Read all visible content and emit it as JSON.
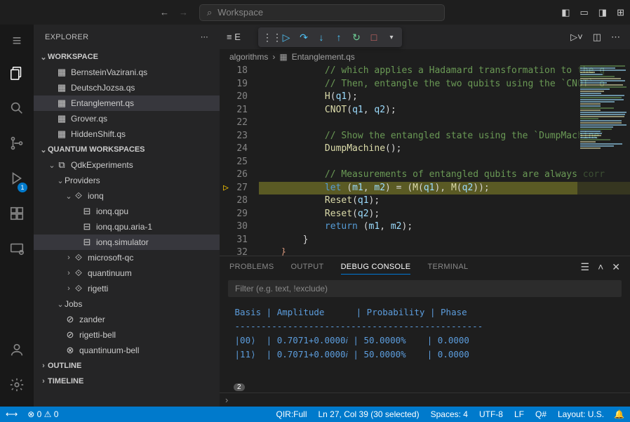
{
  "titlebar": {
    "search_placeholder": "Workspace"
  },
  "sidebar": {
    "title": "EXPLORER",
    "workspace_header": "WORKSPACE",
    "files": [
      "BernsteinVazirani.qs",
      "DeutschJozsa.qs",
      "Entanglement.qs",
      "Grover.qs",
      "HiddenShift.qs"
    ],
    "selected_file_index": 2,
    "quantum_header": "QUANTUM WORKSPACES",
    "quantum_root": "QdkExperiments",
    "providers_label": "Providers",
    "providers": [
      {
        "name": "ionq",
        "expanded": true,
        "targets": [
          "ionq.qpu",
          "ionq.qpu.aria-1",
          "ionq.simulator"
        ]
      },
      {
        "name": "microsoft-qc",
        "expanded": false
      },
      {
        "name": "quantinuum",
        "expanded": false
      },
      {
        "name": "rigetti",
        "expanded": false
      }
    ],
    "jobs_label": "Jobs",
    "jobs": [
      {
        "name": "zander",
        "status": "ok"
      },
      {
        "name": "rigetti-bell",
        "status": "ok"
      },
      {
        "name": "quantinuum-bell",
        "status": "fail"
      }
    ],
    "outline": "OUTLINE",
    "timeline": "TIMELINE"
  },
  "breadcrumbs": {
    "folder": "algorithms",
    "file": "Entanglement.qs"
  },
  "editor": {
    "first_line_no": 18,
    "highlight_index": 9,
    "lines": [
      {
        "indent": 2,
        "segs": [
          [
            "c",
            "// which applies a Hadamard transformation to the q"
          ]
        ]
      },
      {
        "indent": 2,
        "segs": [
          [
            "c",
            "// Then, entangle the two qubits using the `CNOT` o"
          ]
        ]
      },
      {
        "indent": 2,
        "segs": [
          [
            "fn",
            "H"
          ],
          [
            "p",
            "("
          ],
          [
            "v",
            "q1"
          ],
          [
            "p",
            ");"
          ]
        ]
      },
      {
        "indent": 2,
        "segs": [
          [
            "fn",
            "CNOT"
          ],
          [
            "p",
            "("
          ],
          [
            "v",
            "q1"
          ],
          [
            "p",
            ", "
          ],
          [
            "v",
            "q2"
          ],
          [
            "p",
            ");"
          ]
        ]
      },
      {
        "indent": 0,
        "segs": []
      },
      {
        "indent": 2,
        "segs": [
          [
            "c",
            "// Show the entangled state using the `DumpMachine`"
          ]
        ]
      },
      {
        "indent": 2,
        "segs": [
          [
            "fn",
            "DumpMachine"
          ],
          [
            "p",
            "();"
          ]
        ]
      },
      {
        "indent": 0,
        "segs": []
      },
      {
        "indent": 2,
        "segs": [
          [
            "c",
            "// Measurements of entangled qubits are always corr"
          ]
        ]
      },
      {
        "indent": 2,
        "segs": [
          [
            "kw",
            "let"
          ],
          [
            "p",
            " ("
          ],
          [
            "v",
            "m1"
          ],
          [
            "p",
            ", "
          ],
          [
            "v",
            "m2"
          ],
          [
            "p",
            ") = ("
          ],
          [
            "fn",
            "M"
          ],
          [
            "p",
            "("
          ],
          [
            "v",
            "q1"
          ],
          [
            "p",
            "), "
          ],
          [
            "fn",
            "M"
          ],
          [
            "p",
            "("
          ],
          [
            "v",
            "q2"
          ],
          [
            "p",
            "));"
          ]
        ]
      },
      {
        "indent": 2,
        "segs": [
          [
            "fn",
            "Reset"
          ],
          [
            "p",
            "("
          ],
          [
            "v",
            "q1"
          ],
          [
            "p",
            ");"
          ]
        ]
      },
      {
        "indent": 2,
        "segs": [
          [
            "fn",
            "Reset"
          ],
          [
            "p",
            "("
          ],
          [
            "v",
            "q2"
          ],
          [
            "p",
            ");"
          ]
        ]
      },
      {
        "indent": 2,
        "segs": [
          [
            "kw",
            "return"
          ],
          [
            "p",
            " ("
          ],
          [
            "v",
            "m1"
          ],
          [
            "p",
            ", "
          ],
          [
            "v",
            "m2"
          ],
          [
            "p",
            ");"
          ]
        ]
      },
      {
        "indent": 1,
        "segs": [
          [
            "p",
            "}"
          ]
        ]
      },
      {
        "indent": 0,
        "segs": [
          [
            "s",
            "}"
          ]
        ]
      }
    ]
  },
  "panel": {
    "tabs": [
      "PROBLEMS",
      "OUTPUT",
      "DEBUG CONSOLE",
      "TERMINAL"
    ],
    "active_tab": 2,
    "filter_placeholder": "Filter (e.g. text, !exclude)",
    "badge": "2",
    "console_text": " Basis | Amplitude      | Probability | Phase\n -----------------------------------------------\n |00⟩  | 0.7071+0.0000𝑖 | 50.0000%    | 0.0000\n |11⟩  | 0.7071+0.0000𝑖 | 50.0000%    | 0.0000"
  },
  "activity_badge": "1",
  "statusbar": {
    "left": [
      "⊗ 0",
      "⚠ 0"
    ],
    "right": [
      "QIR:Full",
      "Ln 27, Col 39 (30 selected)",
      "Spaces: 4",
      "UTF-8",
      "LF",
      "Q#",
      "Layout: U.S."
    ]
  }
}
